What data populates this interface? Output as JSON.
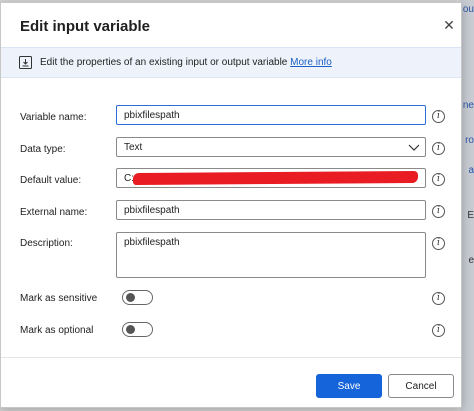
{
  "dialog": {
    "title": "Edit input variable",
    "close_label": "✕"
  },
  "banner": {
    "text": "Edit the properties of an existing input or output variable",
    "link": "More info"
  },
  "fields": {
    "variable_name": {
      "label": "Variable name:",
      "value": "pbixfilespath"
    },
    "data_type": {
      "label": "Data type:",
      "value": "Text"
    },
    "default_value": {
      "label": "Default value:",
      "value": "C:"
    },
    "external_name": {
      "label": "External name:",
      "value": "pbixfilespath"
    },
    "description": {
      "label": "Description:",
      "value": "pbixfilespath"
    },
    "mark_sensitive": {
      "label": "Mark as sensitive",
      "on": false
    },
    "mark_optional": {
      "label": "Mark as optional",
      "on": false
    }
  },
  "buttons": {
    "save": "Save",
    "cancel": "Cancel"
  },
  "colors": {
    "accent": "#1564d9",
    "redaction": "#e81c22",
    "banner_bg": "#eef3fb"
  },
  "background_fragments": [
    "ou",
    "ne",
    "ro",
    "a",
    "E",
    "e"
  ]
}
